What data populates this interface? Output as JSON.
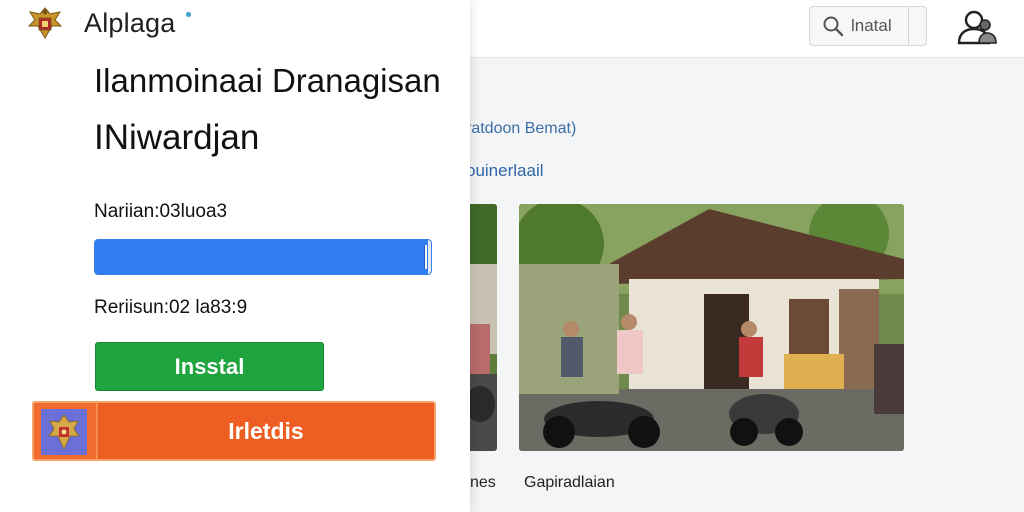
{
  "header": {
    "app_name": "Alplaga",
    "search": {
      "value": "lnatal",
      "icon": "search-icon"
    },
    "profile_icon": "user-avatar-icon"
  },
  "dialog": {
    "title_line1": "Ilanmoinaai Dranagisan",
    "title_line2": "INiwardjan",
    "version_label": "Nariian:03luoa3",
    "progress_percent": 99,
    "date_label": "Reriisun:02 la83:9",
    "install_button_label": "Insstal",
    "secondary_button_label": "Irletdis",
    "colors": {
      "progress": "#2f7df0",
      "install": "#1fa43f",
      "secondary": "#ee5e22"
    }
  },
  "background": {
    "link_text": "ratdoon Bemat)",
    "sublink_text": "ouinerlaail",
    "captions": [
      "nes",
      "Gapiradlaian"
    ]
  }
}
